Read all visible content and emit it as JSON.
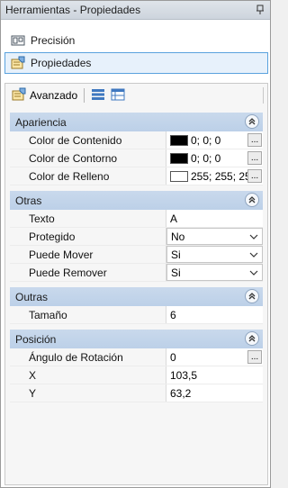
{
  "window": {
    "title": "Herramientas - Propiedades"
  },
  "nav": [
    {
      "label": "Precisión",
      "icon": "precision-icon",
      "selected": false
    },
    {
      "label": "Propiedades",
      "icon": "properties-icon",
      "selected": true
    }
  ],
  "toolbar": {
    "advanced_label": "Avanzado",
    "categorized_icon": "categorized-view-icon",
    "alphabetical_icon": "alphabetical-view-icon"
  },
  "categories": {
    "apariencia": {
      "title": "Apariencia",
      "rows": [
        {
          "label": "Color de Contenido",
          "value": "0; 0; 0",
          "swatch": "#000000"
        },
        {
          "label": "Color de Contorno",
          "value": "0; 0; 0",
          "swatch": "#000000"
        },
        {
          "label": "Color de Relleno",
          "value": "255; 255; 255",
          "swatch": "#ffffff"
        }
      ]
    },
    "otras": {
      "title": "Otras",
      "rows": [
        {
          "label": "Texto",
          "value": "A"
        },
        {
          "label": "Protegido",
          "value": "No"
        },
        {
          "label": "Puede Mover",
          "value": "Si"
        },
        {
          "label": "Puede Remover",
          "value": "Si"
        }
      ]
    },
    "outras": {
      "title": "Outras",
      "rows": [
        {
          "label": "Tamaño",
          "value": "6"
        }
      ]
    },
    "posicion": {
      "title": "Posición",
      "rows": [
        {
          "label": "Ángulo de Rotación",
          "value": "0"
        },
        {
          "label": "X",
          "value": "103,5"
        },
        {
          "label": "Y",
          "value": "63,2"
        }
      ]
    }
  },
  "ellipsis_glyph": "...",
  "colors": {
    "accent": "#5aa2de",
    "category_bg": "#c9d9ec"
  }
}
